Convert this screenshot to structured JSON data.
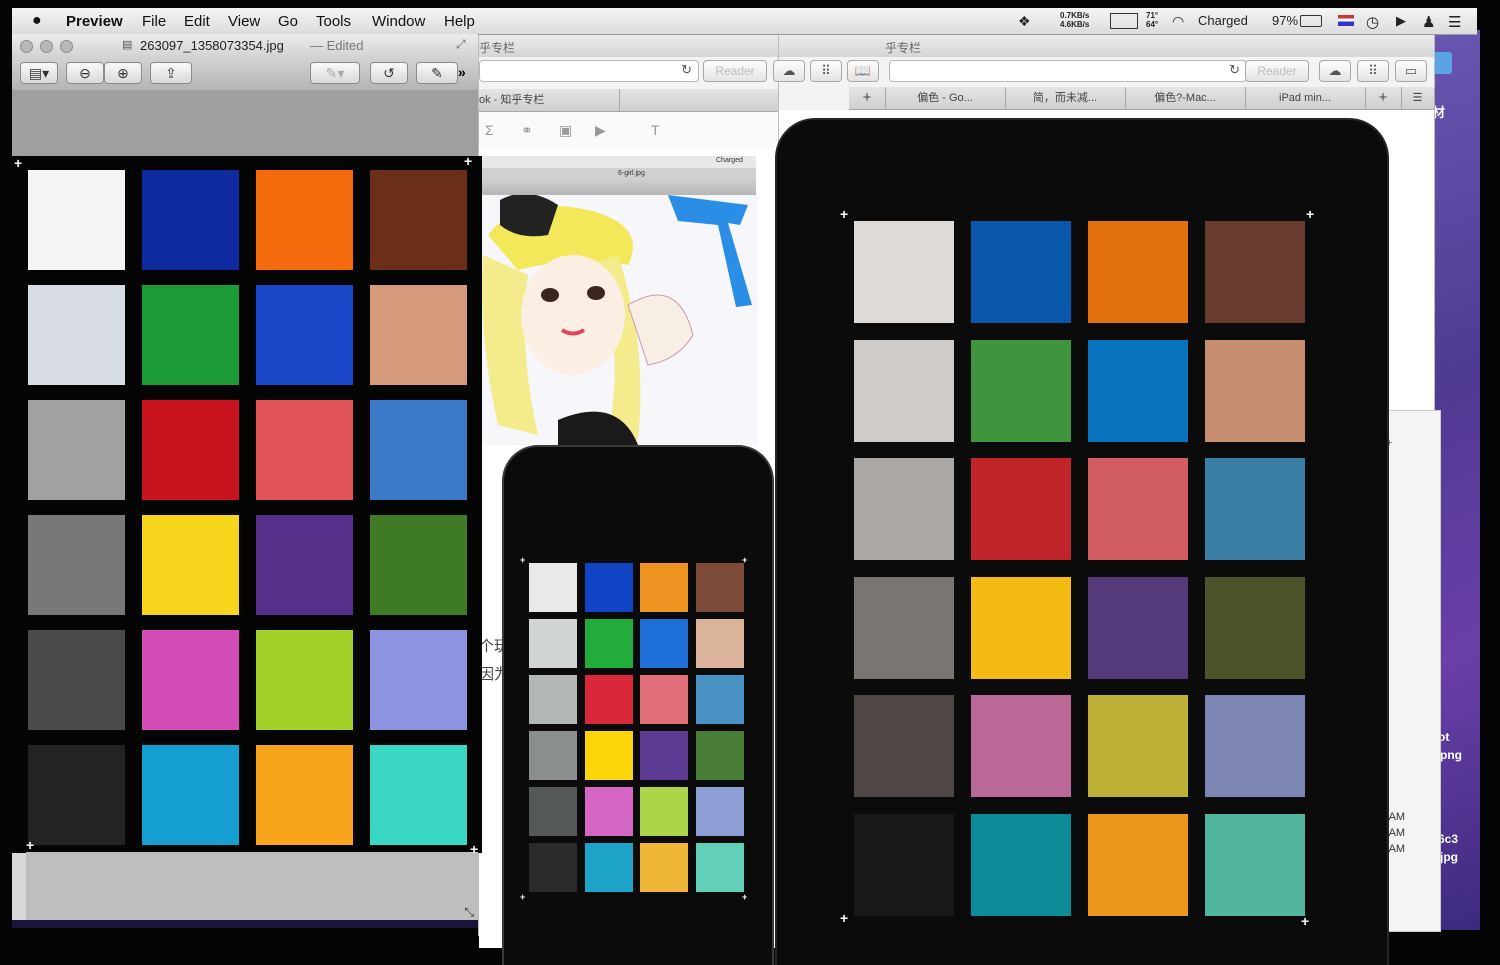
{
  "menubar": {
    "app_name": "Preview",
    "menus": [
      "File",
      "Edit",
      "View",
      "Go",
      "Tools",
      "Window",
      "Help"
    ],
    "net_up": "0.7KB/s",
    "net_down": "4.6KB/s",
    "temp_top": "71°",
    "temp_bottom": "64°",
    "battery_status": "Charged",
    "battery_percent": "97%"
  },
  "preview_window": {
    "filename": "263097_1358073354.jpg",
    "edited_label": "— Edited"
  },
  "browser_back": {
    "reader_label": "Reader",
    "title_fragment": "乎专栏",
    "tab_fragment": "ok - 知乎专栏",
    "side_text": [
      "个玩",
      "因为"
    ]
  },
  "browser_front": {
    "reader_label": "Reader",
    "title_fragment": "乎专栏",
    "tabs": [
      "偏色 - Go...",
      "简，而未减...",
      "偏色?-Mac...",
      "iPad min..."
    ]
  },
  "mini_screen": {
    "status": "Charged",
    "filename": "6-girl.jpg"
  },
  "desktop": {
    "label_material": "材",
    "file1_a": "ot",
    "file1_b": "png",
    "file2_a": "6c3",
    "file2_b": "jpg",
    "times": [
      "7 AM",
      "7 AM",
      "7 AM"
    ]
  },
  "color_chart": {
    "rows": 6,
    "cols": 4,
    "left_colors": [
      "#f4f4f4",
      "#0f2a9e",
      "#f26a0c",
      "#6b2e16",
      "#d8dde3",
      "#1b9a35",
      "#1a47c8",
      "#d59a7c",
      "#a1a1a1",
      "#c8141e",
      "#e05458",
      "#3a7ac6",
      "#787878",
      "#f7d51c",
      "#55308a",
      "#3f7a25",
      "#4a4a4a",
      "#d44db6",
      "#a2d229",
      "#8c93e0",
      "#232323",
      "#159fd0",
      "#f8a41c",
      "#3ad8c2"
    ],
    "phone_colors": [
      "#e8eaea",
      "#1144c4",
      "#ee9422",
      "#7c4a38",
      "#d0d4d4",
      "#22ac3c",
      "#1e6ed8",
      "#dcb49c",
      "#b2b6b6",
      "#d8283a",
      "#e2707a",
      "#4a92c4",
      "#8a8e8e",
      "#fbd508",
      "#5c3c92",
      "#4a7e38",
      "#555858",
      "#d666c4",
      "#acd448",
      "#8c9ed4",
      "#2a2c2c",
      "#1ea4c8",
      "#f0b638",
      "#62d0b8"
    ],
    "tablet_colors": [
      "#dfdad6",
      "#0857a8",
      "#e2700e",
      "#673b2e",
      "#cfcbc8",
      "#3f953e",
      "#0a73be",
      "#c88e72",
      "#aba7a4",
      "#c1242a",
      "#d15c63",
      "#3a7fa3",
      "#7a7472",
      "#f3bb14",
      "#54397b",
      "#4a5428",
      "#504846",
      "#b96898",
      "#bcb036",
      "#7d86b2",
      "#191919",
      "#0c8c98",
      "#eb961c",
      "#51b49c"
    ]
  }
}
